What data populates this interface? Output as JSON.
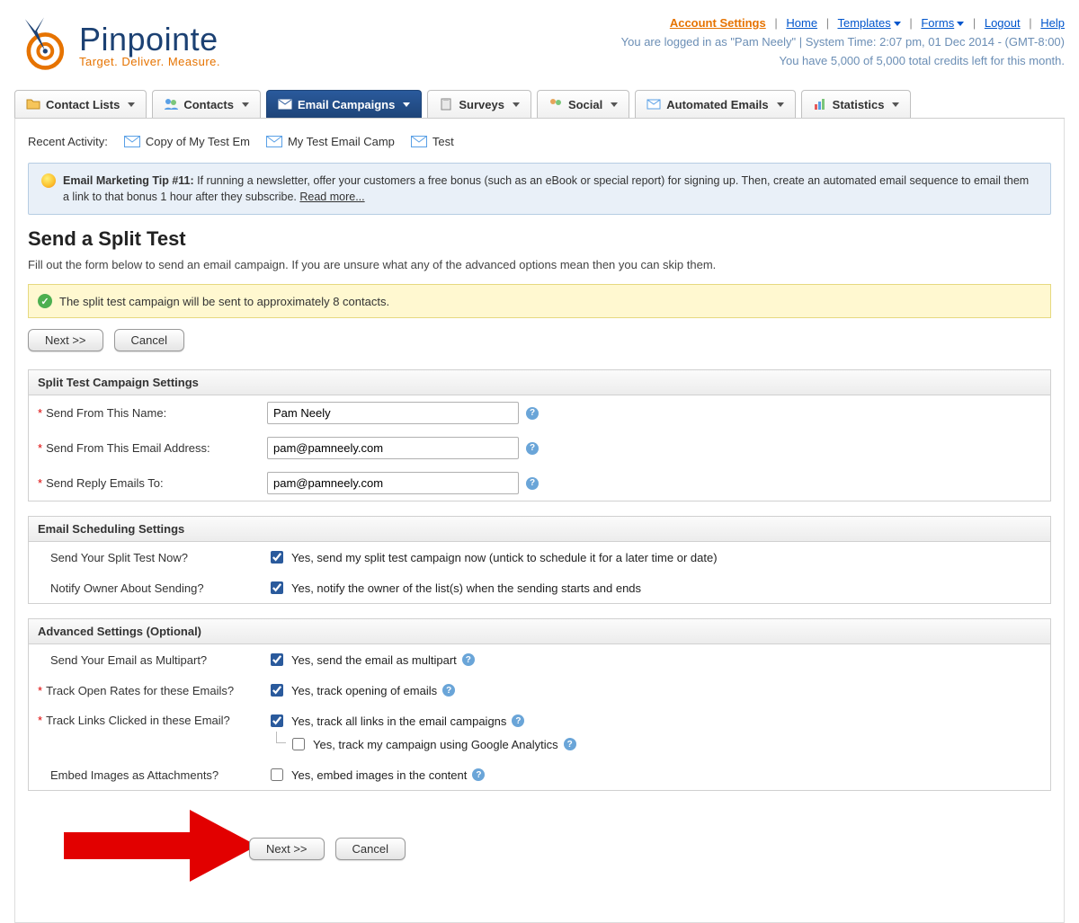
{
  "topnav": {
    "account_settings": "Account Settings",
    "home": "Home",
    "templates": "Templates",
    "forms": "Forms",
    "logout": "Logout",
    "help": "Help"
  },
  "status": {
    "line1": "You are logged in as \"Pam Neely\" | System Time: 2:07 pm, 01 Dec 2014 - (GMT-8:00)",
    "line2": "You have 5,000 of 5,000 total credits left for this month."
  },
  "logo": {
    "name": "Pinpointe",
    "tagline": "Target. Deliver. Measure."
  },
  "tabs": {
    "contact_lists": "Contact Lists",
    "contacts": "Contacts",
    "email_campaigns": "Email Campaigns",
    "surveys": "Surveys",
    "social": "Social",
    "automated_emails": "Automated Emails",
    "statistics": "Statistics"
  },
  "recent": {
    "label": "Recent Activity:",
    "items": [
      "Copy of My Test Em",
      "My Test Email Camp",
      "Test"
    ]
  },
  "tip": {
    "bold": "Email Marketing Tip #11:",
    "text": " If running a newsletter, offer your customers a free bonus (such as an eBook or special report) for signing up. Then, create an automated email sequence to email them a link to that bonus 1 hour after they subscribe. ",
    "read_more": "Read more..."
  },
  "page": {
    "title": "Send a Split Test",
    "subtitle": "Fill out the form below to send an email campaign. If you are unsure what any of the advanced options mean then you can skip them."
  },
  "success": {
    "text": "The split test campaign will be sent to approximately 8 contacts."
  },
  "buttons": {
    "next": "Next >>",
    "cancel": "Cancel"
  },
  "section1": {
    "header": "Split Test Campaign Settings",
    "from_name_label": "Send From This Name:",
    "from_name_value": "Pam Neely",
    "from_email_label": "Send From This Email Address:",
    "from_email_value": "pam@pamneely.com",
    "reply_label": "Send Reply Emails To:",
    "reply_value": "pam@pamneely.com"
  },
  "section2": {
    "header": "Email Scheduling Settings",
    "send_now_label": "Send Your Split Test Now?",
    "send_now_text": "Yes, send my split test campaign now (untick to schedule it for a later time or date)",
    "notify_label": "Notify Owner About Sending?",
    "notify_text": "Yes, notify the owner of the list(s) when the sending starts and ends"
  },
  "section3": {
    "header": "Advanced Settings (Optional)",
    "multipart_label": "Send Your Email as Multipart?",
    "multipart_text": "Yes, send the email as multipart",
    "open_label": "Track Open Rates for these Emails?",
    "open_text": "Yes, track opening of emails",
    "links_label": "Track Links Clicked in these Email?",
    "links_text": "Yes, track all links in the email campaigns",
    "ga_text": "Yes, track my campaign using Google Analytics",
    "embed_label": "Embed Images as Attachments?",
    "embed_text": "Yes, embed images in the content"
  }
}
